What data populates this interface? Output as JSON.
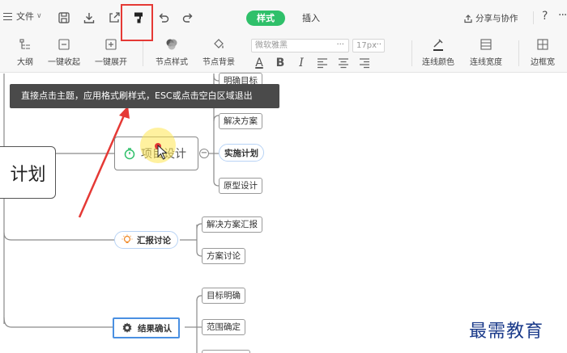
{
  "topbar": {
    "file_label": "文件",
    "tabs": [
      {
        "label": "样式",
        "active": true
      },
      {
        "label": "插入",
        "active": false
      }
    ],
    "share_label": "分享与协作",
    "help_label": "?",
    "more_label": "···"
  },
  "ribbon": {
    "outline_label": "大纲",
    "collapse_label": "一键收起",
    "expand_label": "一键展开",
    "node_style_label": "节点样式",
    "node_bg_label": "节点背景",
    "font_family": "微软雅黑",
    "font_size": "17px",
    "dots": "···",
    "line_color_label": "连线颜色",
    "line_width_label": "连线宽度",
    "border_width_label": "边框宽",
    "format_a": "A",
    "format_b": "B",
    "format_i": "I"
  },
  "tooltip": "直接点击主题，应用格式刷样式，ESC或点击空白区域退出",
  "mindmap": {
    "root_partial": "计划",
    "partial_top_node": "明确目标",
    "main_node": "项目设计",
    "main_children": [
      "解决方案",
      "实施计划",
      "原型设计"
    ],
    "report_node": "汇报讨论",
    "report_children": [
      "解决方案汇报",
      "方案讨论"
    ],
    "confirm_node": "结果确认",
    "confirm_children": [
      "目标明确",
      "范围确定"
    ],
    "collapse_symbol": "−"
  },
  "watermark": "最需教育",
  "colors": {
    "accent_green": "#2fc06a",
    "selection_blue": "#4a90e2",
    "annotation_red": "#e53935",
    "watermark_blue": "#1a3a8a"
  }
}
